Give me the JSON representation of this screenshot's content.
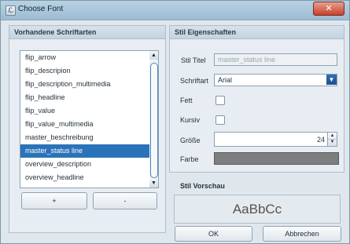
{
  "window": {
    "title": "Choose Font",
    "close_symbol": "✕"
  },
  "left_panel": {
    "header": "Vorhandene Schriftarten",
    "items": [
      "flip_arrow",
      "flip_descripion",
      "flip_description_multimedia",
      "flip_headline",
      "flip_value",
      "flip_value_multimedia",
      "master_beschreibung",
      "master_status line",
      "overview_description",
      "overview_headline"
    ],
    "selected_item": "master_status line",
    "add_button": "+",
    "remove_button": "-"
  },
  "right_panel": {
    "header": "Stil Eigenschaften",
    "stil_titel_label": "Stil Titel",
    "stil_titel_value": "master_status line",
    "schriftart_label": "Schriftart",
    "schriftart_value": "Arial",
    "fett_label": "Fett",
    "kursiv_label": "Kursiv",
    "groesse_label": "Größe",
    "groesse_value": "24",
    "farbe_label": "Farbe",
    "farbe_color": "#7e7e7e"
  },
  "preview": {
    "header": "Stil Vorschau",
    "sample_text": "AaBbCc"
  },
  "footer": {
    "ok_button": "OK",
    "cancel_button": "Abbrechen"
  }
}
